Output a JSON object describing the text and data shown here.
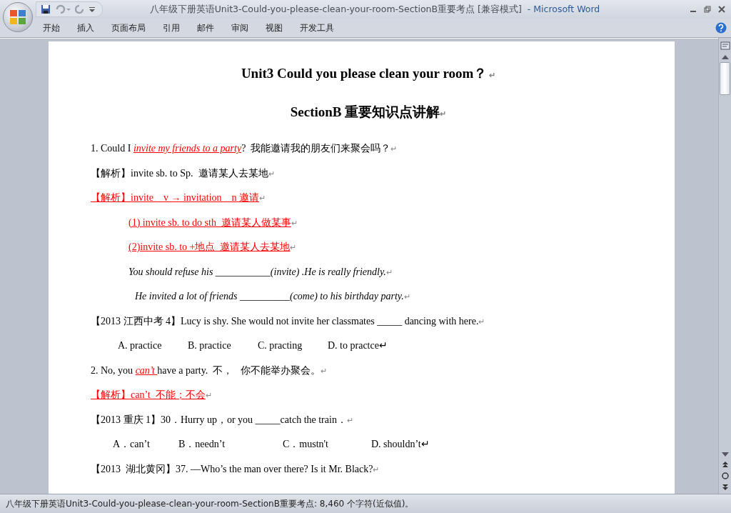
{
  "window": {
    "title": "八年级下册英语Unit3-Could-you-please-clean-your-room-SectionB重要考点 [兼容模式]",
    "app_name": "- Microsoft Word"
  },
  "tabs": [
    {
      "label": "开始",
      "selected": false
    },
    {
      "label": "插入",
      "selected": false
    },
    {
      "label": "页面布局",
      "selected": false
    },
    {
      "label": "引用",
      "selected": false
    },
    {
      "label": "邮件",
      "selected": false
    },
    {
      "label": "审阅",
      "selected": false
    },
    {
      "label": "视图",
      "selected": false
    },
    {
      "label": "开发工具",
      "selected": false
    }
  ],
  "document": [
    {
      "kind": "heading",
      "runs": [
        {
          "text": "Unit3 Could you please clean your room？",
          "kind": "plain"
        },
        {
          "text": " ↵",
          "kind": "mark"
        }
      ]
    },
    {
      "kind": "heading",
      "runs": [
        {
          "text": "SectionB 重要知识点讲解",
          "kind": "plain"
        },
        {
          "text": "↵",
          "kind": "mark"
        }
      ]
    },
    {
      "kind": "para",
      "runs": [
        {
          "text": "1. Could I ",
          "kind": "plain"
        },
        {
          "text": "invite my friends to a party",
          "kind": "red-italic"
        },
        {
          "text": "?  我能邀请我的朋友们来聚会吗？",
          "kind": "plain"
        },
        {
          "text": "↵",
          "kind": "mark"
        }
      ]
    },
    {
      "kind": "para",
      "runs": [
        {
          "text": "【解析】invite sb. to Sp.  邀请某人去某地",
          "kind": "plain"
        },
        {
          "text": "↵",
          "kind": "mark"
        }
      ]
    },
    {
      "kind": "para",
      "runs": [
        {
          "text": "【解析】invite    v → invitation    n 邀请",
          "kind": "red"
        },
        {
          "text": "↵",
          "kind": "mark"
        }
      ]
    },
    {
      "kind": "indent",
      "runs": [
        {
          "text": "(1) invite sb. to do sth  邀请某人做某事",
          "kind": "red"
        },
        {
          "text": "↵",
          "kind": "mark"
        }
      ]
    },
    {
      "kind": "indent",
      "runs": [
        {
          "text": "(2)invite sb. to +地点  邀请某人去某地",
          "kind": "red"
        },
        {
          "text": "↵",
          "kind": "mark"
        }
      ]
    },
    {
      "kind": "indent",
      "runs": [
        {
          "text": "You should refuse his ___________(invite) .He is really friendly.",
          "kind": "italic"
        },
        {
          "text": "↵",
          "kind": "mark"
        }
      ]
    },
    {
      "kind": "indent-more",
      "runs": [
        {
          "text": "He invited a lot of friends __________(come) to his birthday party.",
          "kind": "italic"
        },
        {
          "text": "↵",
          "kind": "mark"
        }
      ]
    },
    {
      "kind": "para",
      "runs": [
        {
          "text": "【2013 江西中考 4】Lucy is shy. She would not invite her classmates _____ dancing with here.",
          "kind": "plain"
        },
        {
          "text": "↵",
          "kind": "mark"
        }
      ]
    },
    {
      "kind": "options",
      "options": [
        "A. practice",
        "B. practice",
        "C. practing",
        "D. to practce↵"
      ]
    },
    {
      "kind": "para",
      "runs": [
        {
          "text": "2. No, you ",
          "kind": "plain"
        },
        {
          "text": "can’t ",
          "kind": "red-italic"
        },
        {
          "text": "have a party.  不，   你不能举办聚会。",
          "kind": "plain"
        },
        {
          "text": "↵",
          "kind": "mark"
        }
      ]
    },
    {
      "kind": "para",
      "runs": [
        {
          "text": "【解析】can’t  不能；不会",
          "kind": "red"
        },
        {
          "text": "↵",
          "kind": "mark"
        }
      ]
    },
    {
      "kind": "para",
      "runs": [
        {
          "text": "【2013 重庆 1】30．Hurry up，or you _____catch the train．",
          "kind": "plain"
        },
        {
          "text": "↵",
          "kind": "mark"
        }
      ]
    },
    {
      "kind": "options-wide",
      "options": [
        "A．can’t",
        "B．needn’t",
        "C．mustn't",
        "D. shouldn’t↵"
      ]
    },
    {
      "kind": "para",
      "runs": [
        {
          "text": "【2013  湖北黄冈】37. —Who’s the man over there? Is it Mr. Black?",
          "kind": "plain"
        },
        {
          "text": "↵",
          "kind": "mark"
        }
      ]
    }
  ],
  "status_bar": {
    "text": "八年级下册英语Unit3-Could-you-please-clean-your-room-SectionB重要考点: 8,460 个字符(近似值)。"
  }
}
